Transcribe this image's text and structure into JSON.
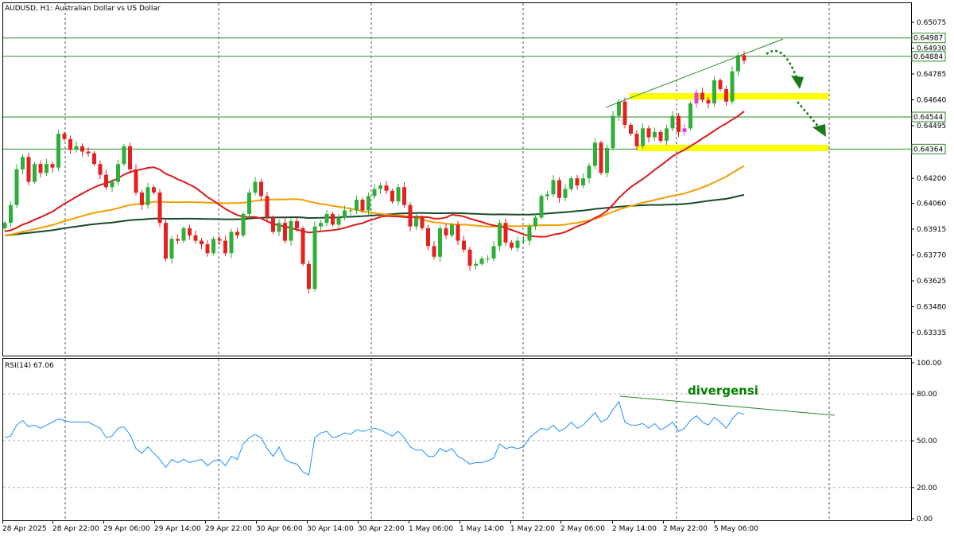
{
  "chart_title": "AUDUSD, H1:  Australian Dollar vs US Dollar",
  "rsi_title": "RSI(14) 67.06",
  "divergence_label": "divergensi",
  "colors": {
    "up": "#2eaf39",
    "down": "#e62020",
    "highlight": "#e040d0",
    "ma_fast": "#dc1a1a",
    "ma_mid": "#f0a000",
    "ma_slow": "#1a4a2a",
    "level_line": "#2a8a2a",
    "zone": "#ffff00",
    "rsi": "#1e90ff",
    "trendline": "#2a8a2a",
    "arrow": "#1a7a1a",
    "grid": "#555555",
    "price_box_border": "#2a8a2a"
  },
  "chart_data": [
    {
      "type": "candlestick",
      "symbol": "AUDUSD",
      "timeframe": "H1",
      "title": "AUDUSD, H1:  Australian Dollar vs US Dollar",
      "y_ticks": [
        0.65075,
        0.6493,
        0.64785,
        0.6464,
        0.64495,
        0.6435,
        0.642,
        0.6406,
        0.63915,
        0.6377,
        0.63625,
        0.6348,
        0.63335
      ],
      "y_tick_labels": [
        "0.65075",
        "0.64930",
        "0.64785",
        "0.64640",
        "0.64495",
        "0.64350",
        "0.64200",
        "0.64060",
        "0.63915",
        "0.63770",
        "0.63625",
        "0.63480",
        "0.63335"
      ],
      "ylim": [
        0.6319,
        0.652
      ],
      "x_tick_labels": [
        "28 Apr 2025",
        "28 Apr 22:00",
        "29 Apr 06:00",
        "29 Apr 14:00",
        "29 Apr 22:00",
        "30 Apr 06:00",
        "30 Apr 14:00",
        "30 Apr 22:00",
        "1 May 06:00",
        "1 May 14:00",
        "1 May 22:00",
        "2 May 06:00",
        "2 May 14:00",
        "2 May 22:00",
        "5 May 06:00"
      ],
      "price_levels": [
        {
          "label": "0.64987",
          "value": 0.64987
        },
        {
          "label": "0.64884",
          "value": 0.64884
        },
        {
          "label": "0.64544",
          "value": 0.64544
        },
        {
          "label": "0.64364",
          "value": 0.64364
        }
      ],
      "support_zones": [
        {
          "value": 0.6466
        },
        {
          "value": 0.6437
        }
      ],
      "closes": [
        0.6395,
        0.6405,
        0.6425,
        0.6432,
        0.6418,
        0.6428,
        0.6423,
        0.6428,
        0.6426,
        0.6445,
        0.6442,
        0.6436,
        0.6438,
        0.6435,
        0.6434,
        0.6428,
        0.6422,
        0.6415,
        0.6418,
        0.6428,
        0.6438,
        0.6425,
        0.6412,
        0.6405,
        0.6415,
        0.6412,
        0.6395,
        0.6375,
        0.6386,
        0.6385,
        0.6392,
        0.6388,
        0.6385,
        0.6383,
        0.6378,
        0.6386,
        0.6385,
        0.6378,
        0.639,
        0.6388,
        0.64,
        0.6412,
        0.6418,
        0.641,
        0.6398,
        0.639,
        0.6395,
        0.6385,
        0.6396,
        0.6392,
        0.6372,
        0.6358,
        0.6393,
        0.6395,
        0.64,
        0.6394,
        0.6398,
        0.6402,
        0.6402,
        0.6408,
        0.6402,
        0.641,
        0.6414,
        0.6416,
        0.6413,
        0.6407,
        0.6415,
        0.6405,
        0.6393,
        0.6398,
        0.6392,
        0.6382,
        0.6376,
        0.6392,
        0.6388,
        0.6394,
        0.6385,
        0.638,
        0.6371,
        0.6372,
        0.6375,
        0.6375,
        0.6382,
        0.6395,
        0.6384,
        0.6381,
        0.6385,
        0.6385,
        0.6393,
        0.6398,
        0.641,
        0.6411,
        0.6419,
        0.6409,
        0.6414,
        0.642,
        0.6416,
        0.642,
        0.6427,
        0.644,
        0.6423,
        0.6437,
        0.6455,
        0.6463,
        0.645,
        0.6445,
        0.6438,
        0.6448,
        0.6443,
        0.6446,
        0.6441,
        0.6448,
        0.6455,
        0.6446,
        0.6448,
        0.6462,
        0.6468,
        0.6464,
        0.6462,
        0.6475,
        0.647,
        0.6463,
        0.648,
        0.6489,
        0.6486
      ],
      "rsi": {
        "title": "RSI(14) 67.06",
        "y_ticks": [
          100,
          80,
          50,
          20,
          0
        ],
        "y_tick_labels": [
          "100.00",
          "80.00",
          "50.00",
          "20.00",
          "0.00"
        ],
        "ylim": [
          0,
          100
        ],
        "last_value": 67.06,
        "values": [
          52,
          53,
          60,
          63,
          59,
          60,
          58,
          60,
          62,
          64,
          63,
          62,
          62,
          62,
          62,
          60,
          58,
          52,
          53,
          58,
          59,
          54,
          45,
          42,
          46,
          42,
          38,
          33,
          38,
          36,
          38,
          36,
          37,
          38,
          34,
          37,
          38,
          34,
          40,
          38,
          48,
          52,
          54,
          52,
          45,
          40,
          46,
          38,
          36,
          35,
          30,
          28,
          52,
          55,
          56,
          52,
          53,
          55,
          54,
          57,
          56,
          57,
          58,
          57,
          55,
          53,
          56,
          52,
          46,
          44,
          44,
          40,
          40,
          45,
          43,
          45,
          40,
          38,
          35,
          36,
          36,
          37,
          39,
          48,
          45,
          46,
          45,
          46,
          52,
          55,
          58,
          57,
          60,
          56,
          58,
          62,
          58,
          60,
          64,
          68,
          62,
          64,
          70,
          75,
          62,
          60,
          60,
          61,
          58,
          61,
          57,
          59,
          62,
          56,
          58,
          63,
          66,
          62,
          60,
          65,
          62,
          58,
          64,
          68,
          67
        ]
      }
    }
  ]
}
